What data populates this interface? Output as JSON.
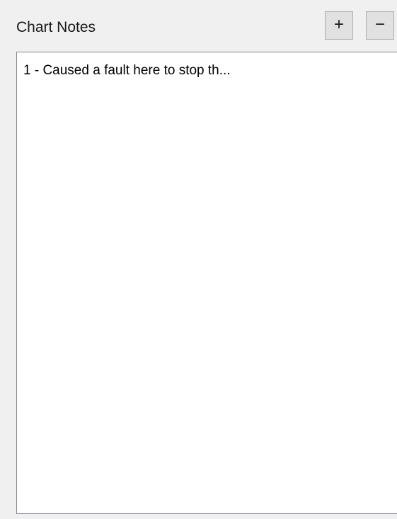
{
  "panel": {
    "title": "Chart Notes",
    "add_button_label": "+",
    "remove_button_label": "−",
    "add_button_icon": "plus-icon",
    "remove_button_icon": "minus-icon"
  },
  "notes": [
    {
      "text": "1 - Caused a fault here to stop th..."
    }
  ]
}
